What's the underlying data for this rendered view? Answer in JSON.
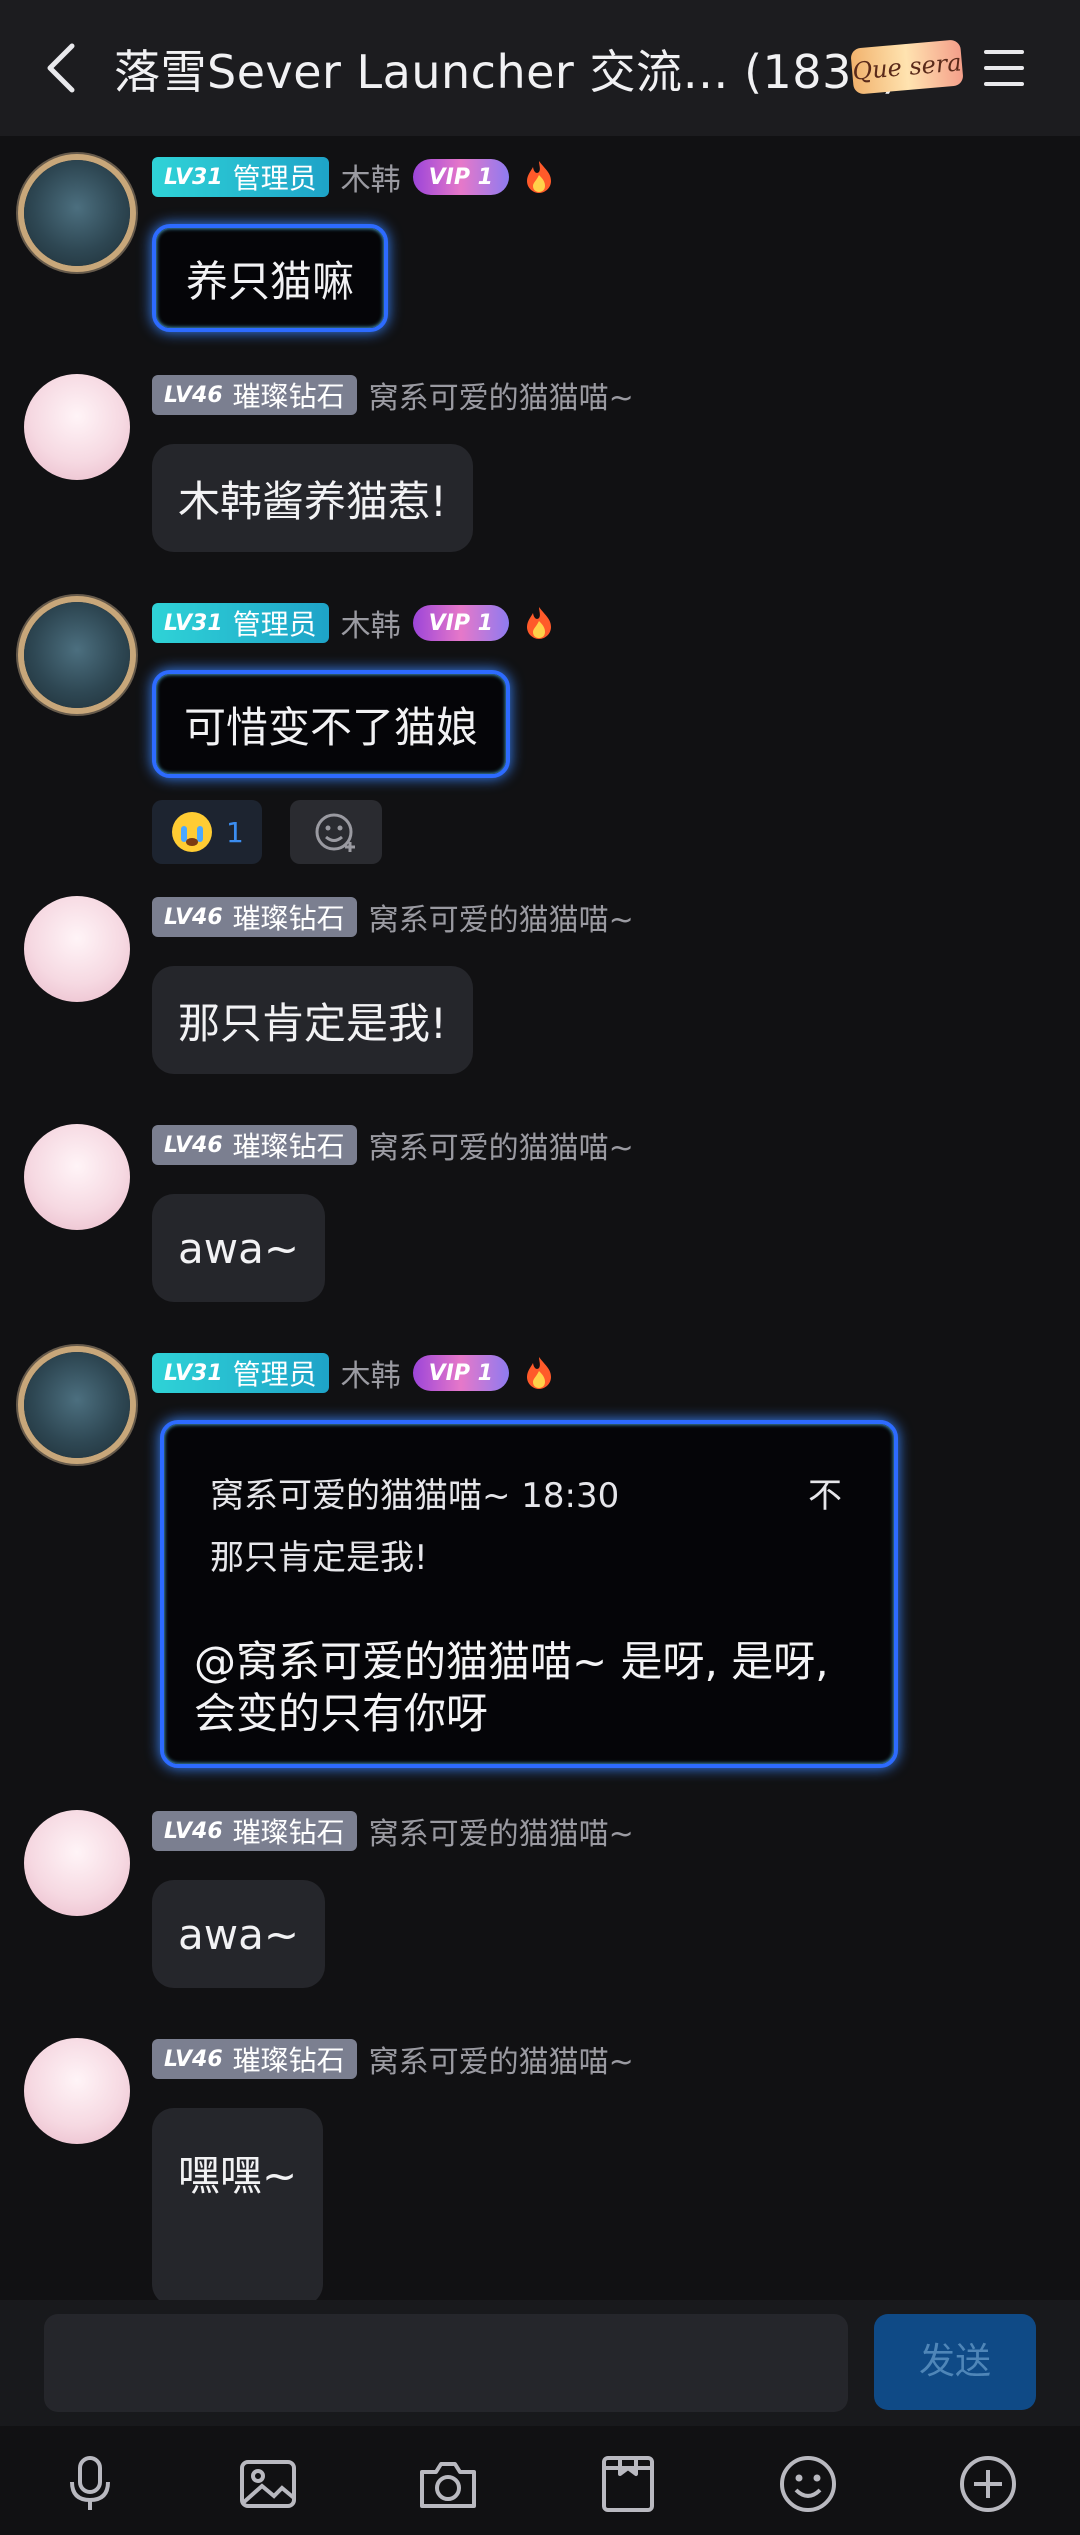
{
  "header": {
    "title": "落雪Sever Launcher 交流… (1835)",
    "badge": "Que sera"
  },
  "messages": [
    {
      "level": "LV31",
      "title": "管理员",
      "name": "木韩",
      "vip": "VIP 1",
      "text": "养只猫嘛"
    },
    {
      "level": "LV46",
      "title": "璀璨钻石",
      "name": "窝系可爱的猫猫喵~",
      "text": "木韩酱养猫惹!"
    },
    {
      "level": "LV31",
      "title": "管理员",
      "name": "木韩",
      "vip": "VIP 1",
      "text": "可惜变不了猫娘",
      "reaction_count": "1"
    },
    {
      "level": "LV46",
      "title": "璀璨钻石",
      "name": "窝系可爱的猫猫喵~",
      "text": "那只肯定是我!"
    },
    {
      "level": "LV46",
      "title": "璀璨钻石",
      "name": "窝系可爱的猫猫喵~",
      "text": "awa~"
    },
    {
      "level": "LV31",
      "title": "管理员",
      "name": "木韩",
      "vip": "VIP 1",
      "quote_head": "窝系可爱的猫猫喵~ 18:30",
      "quote_mark": "不",
      "quote_text": "那只肯定是我!",
      "text": "@窝系可爱的猫猫喵~ 是呀, 是呀, 会变的只有你呀"
    },
    {
      "level": "LV46",
      "title": "璀璨钻石",
      "name": "窝系可爱的猫猫喵~",
      "text": "awa~"
    },
    {
      "level": "LV46",
      "title": "璀璨钻石",
      "name": "窝系可爱的猫猫喵~",
      "text": "嘿嘿~"
    }
  ],
  "input": {
    "placeholder": "",
    "send_label": "发送"
  },
  "toolbar": [
    "microphone-icon",
    "image-icon",
    "camera-icon",
    "gift-icon",
    "emoji-icon",
    "plus-icon"
  ]
}
